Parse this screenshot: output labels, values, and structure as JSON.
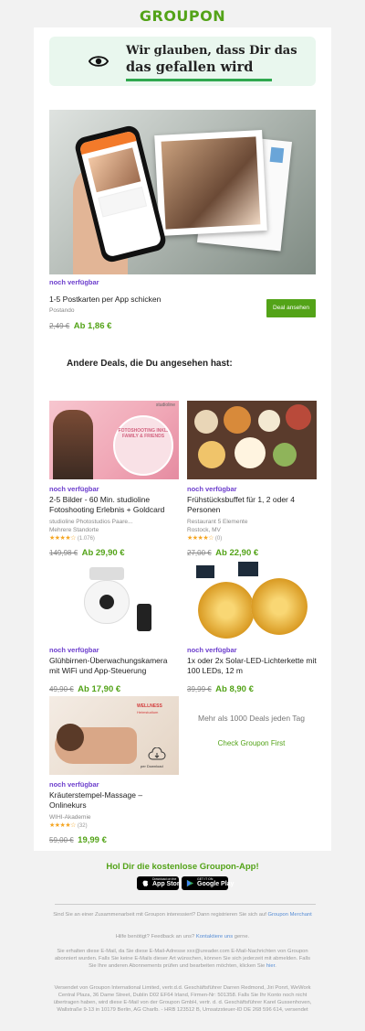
{
  "logo": "GROUPON",
  "banner": {
    "line1": "Wir glauben, dass Dir das",
    "line2": "das gefallen wird",
    "icon": "eye-icon"
  },
  "featured": {
    "postcard_brand": "myphotocards",
    "availability": "noch verfügbar",
    "title": "1-5 Postkarten per App schicken",
    "merchant": "Postando",
    "old_price": "2,49 €",
    "new_price": "Ab 1,86 €",
    "button": "Deal ansehen"
  },
  "section_title": "Andere Deals, die Du angesehen hast:",
  "deals": [
    {
      "badge": "studioline",
      "thumb_text": "FOTOSHOOTING INKL. FAMILY & FRIENDS",
      "availability": "noch verfügbar",
      "title": "2-5 Bilder - 60 Min. studioline Fotoshooting Erlebnis + Goldcard",
      "merchant": "studioline Photostudios Paare...",
      "location": "Mehrere Standorte",
      "stars": 4,
      "count": "(1.076)",
      "old_price": "149,98 €",
      "new_price": "Ab 29,90 €"
    },
    {
      "availability": "noch verfügbar",
      "title": "Frühstücksbuffet für 1, 2 oder 4 Personen",
      "merchant": "Restaurant 5 Elemente",
      "location": "Rostock, MV",
      "stars": 4,
      "count": "(0)",
      "old_price": "27,00 €",
      "new_price": "Ab 22,90 €"
    },
    {
      "availability": "noch verfügbar",
      "title": "Glühbirnen-Überwachungskamera mit WiFi und App-Steuerung",
      "old_price": "49,90 €",
      "new_price": "Ab 17,90 €"
    },
    {
      "availability": "noch verfügbar",
      "title": "1x oder 2x Solar-LED-Lichterkette mit 100 LEDs, 12 m",
      "old_price": "39,99 €",
      "new_price": "Ab 8,90 €"
    },
    {
      "badge_line1": "WELLNESS",
      "badge_line2": "Heimstudium",
      "download": "per Download",
      "availability": "noch verfügbar",
      "title": "Kräuterstempel-Massage – Onlinekurs",
      "merchant": "WIHI-Akademie",
      "stars": 4,
      "count": "(32)",
      "old_price": "59,00 €",
      "new_price": "19,99 €"
    }
  ],
  "more": {
    "text": "Mehr als 1000 Deals jeden Tag",
    "link": "Check Groupon First"
  },
  "app": {
    "title": "Hol Dir die kostenlose Groupon-App!",
    "appstore_small": "Download on the",
    "appstore_big": "App Store",
    "play_small": "GET IT ON",
    "play_big": "Google Play"
  },
  "footer": {
    "merchant_text": "Sind Sie an einer Zusammenarbeit mit Groupon interessiert? Dann registrieren Sie sich auf",
    "merchant_link": "Groupon Merchant",
    "help_text": "Hilfe benötigt? Feedback an uns?",
    "help_link": "Kontaktiere uns",
    "help_suffix": "gerne.",
    "subscription_text": "Sie erhalten diese E-Mail, da Sie diese E-Mail-Adresse xxx@ureader.com E-Mail-Nachrichten von Groupon abonniert wurden. Falls Sie keine E-Mails dieser Art wünschen, können Sie sich jederzeit mit abmelden. Falls Sie Ihre anderen Abonnements prüfen und bearbeiten möchten, klicken Sie",
    "subscription_link": "hier",
    "legal": "Versendet von Groupon International Limited, vertr.d.d. Geschäftsführer Darren Redmond, Jiri Ponrt, WeWork Central Plaza, 36 Dame Street, Dublin D02 EF64 Irland, Firmen-Nr: 501358. Falls Sie Ihr Konto noch nicht übertragen haben, wird diese E-Mail von der Groupon GmbH, vertr. d. d. Geschäftsführer Karel Gussenhoven, Wallstraße 9-13 in 10179 Berlin, AG Charlb. - HRB 123512 B, Umsatzsteuer-ID DE 268 596 614, versendet"
  }
}
